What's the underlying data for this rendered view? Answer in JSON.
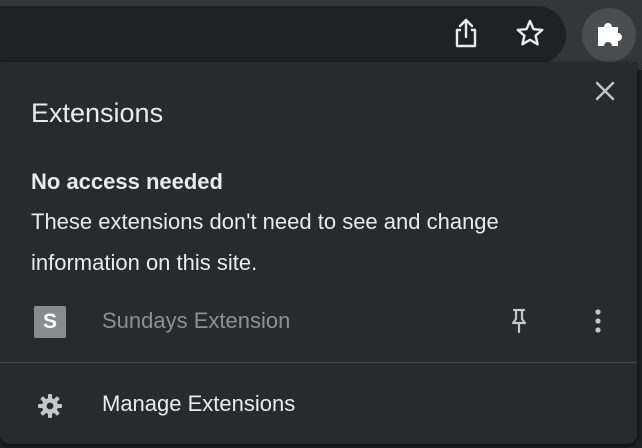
{
  "toolbar": {
    "share_icon": "share-icon",
    "bookmark_icon": "star-icon",
    "extensions_icon": "puzzle-icon"
  },
  "panel": {
    "title": "Extensions",
    "close_icon": "close-icon",
    "section": {
      "heading": "No access needed",
      "description": "These extensions don't need to see and change information on this site."
    },
    "extensions": [
      {
        "favicon_letter": "S",
        "name": "Sundays Extension",
        "pin_icon": "pin-icon",
        "more_icon": "more-vert-icon"
      }
    ],
    "manage": {
      "icon": "gear-icon",
      "label": "Manage Extensions"
    }
  },
  "colors": {
    "toolbar_bg": "#35363a",
    "panel_bg": "#292a2d",
    "text_primary": "#e8eaed",
    "text_disabled": "#8d8f93"
  }
}
